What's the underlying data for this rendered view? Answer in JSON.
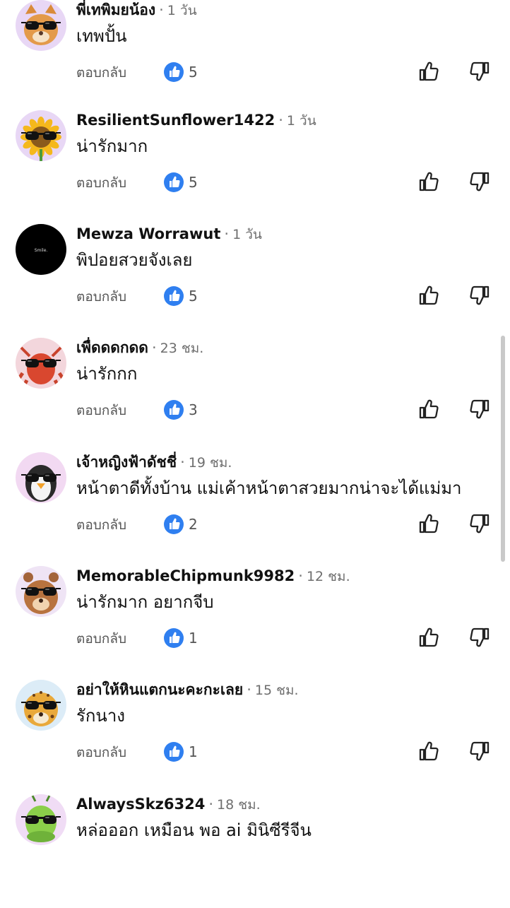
{
  "ui": {
    "reply_label": "ตอบกลับ",
    "dot": "·"
  },
  "colors": {
    "like_blue": "#2f7ff0",
    "name": "#111111",
    "meta": "#6e6e6e"
  },
  "comments": [
    {
      "name": "พี่เทพิมยน้อง",
      "time": "1 วัน",
      "text": "เทพปั้น",
      "likes": "5",
      "avatar_icon": "cat-sunglasses-avatar"
    },
    {
      "name": "ResilientSunflower1422",
      "time": "1 วัน",
      "text": "น่ารักมาก",
      "likes": "5",
      "avatar_icon": "sunflower-sunglasses-avatar"
    },
    {
      "name": "Mewza Worrawut",
      "time": "1 วัน",
      "text": "พิปอยสวยจังเลย",
      "likes": "5",
      "avatar_icon": "black-circle-avatar",
      "avatar_text": "Smile."
    },
    {
      "name": "เพื่ดดดกดด",
      "time": "23 ชม.",
      "text": "น่ารักกก",
      "likes": "3",
      "avatar_icon": "lobster-sunglasses-avatar"
    },
    {
      "name": "เจ้าหญิงฟ้าดัชชี่",
      "time": "19 ชม.",
      "text": "หน้าตาดีทั้งบ้าน แม่เค้าหน้าตาสวยมากน่าจะได้แม่มา",
      "likes": "2",
      "avatar_icon": "penguin-sunglasses-avatar"
    },
    {
      "name": "MemorableChipmunk9982",
      "time": "12 ชม.",
      "text": "น่ารักมาก อยากจีบ",
      "likes": "1",
      "avatar_icon": "chipmunk-sunglasses-avatar"
    },
    {
      "name": "อย่าให้หินแตกนะคะกะเลย",
      "time": "15 ชม.",
      "text": "รักนาง",
      "likes": "1",
      "avatar_icon": "leopard-sunglasses-avatar"
    },
    {
      "name": "AlwaysSkz6324",
      "time": "18 ชม.",
      "text": "หล่อออก เหมือน พอ ai มินิซีรีจีน",
      "likes": "",
      "avatar_icon": "caterpillar-sunglasses-avatar"
    }
  ]
}
